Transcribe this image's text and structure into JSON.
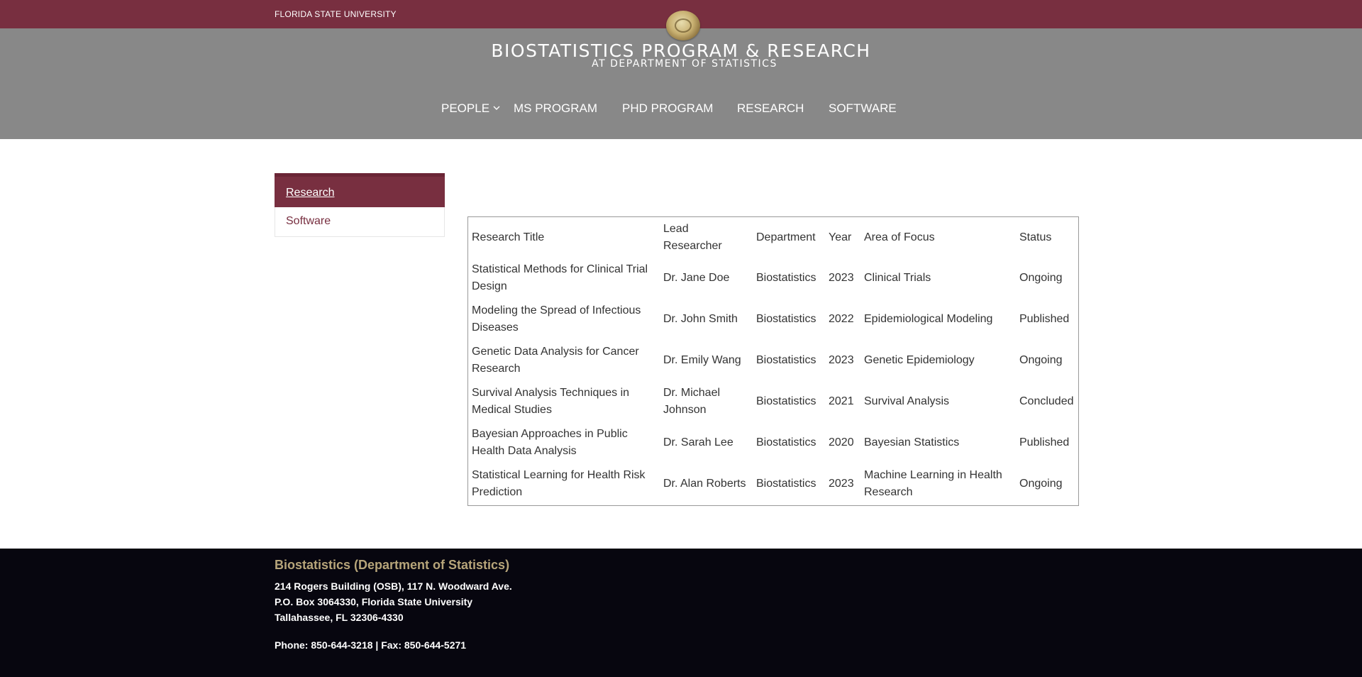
{
  "topbar": {
    "university": "FLORIDA STATE UNIVERSITY"
  },
  "header": {
    "title": "BIOSTATISTICS PROGRAM & RESEARCH",
    "subtitle": "AT DEPARTMENT OF STATISTICS",
    "seal_icon": "university-seal-icon"
  },
  "nav": {
    "items": [
      {
        "label": "PEOPLE",
        "has_dropdown": true
      },
      {
        "label": "MS PROGRAM"
      },
      {
        "label": "PHD PROGRAM"
      },
      {
        "label": "RESEARCH"
      },
      {
        "label": "SOFTWARE"
      }
    ]
  },
  "sidebar": {
    "items": [
      {
        "label": "Research",
        "active": true
      },
      {
        "label": "Software",
        "active": false
      }
    ]
  },
  "table": {
    "headers": [
      "Research Title",
      "Lead Researcher",
      "Department",
      "Year",
      "Area of Focus",
      "Status"
    ],
    "rows": [
      [
        "Statistical Methods for Clinical Trial Design",
        "Dr. Jane Doe",
        "Biostatistics",
        "2023",
        "Clinical Trials",
        "Ongoing"
      ],
      [
        "Modeling the Spread of Infectious Diseases",
        "Dr. John Smith",
        "Biostatistics",
        "2022",
        "Epidemiological Modeling",
        "Published"
      ],
      [
        "Genetic Data Analysis for Cancer Research",
        "Dr. Emily Wang",
        "Biostatistics",
        "2023",
        "Genetic Epidemiology",
        "Ongoing"
      ],
      [
        "Survival Analysis Techniques in Medical Studies",
        "Dr. Michael Johnson",
        "Biostatistics",
        "2021",
        "Survival Analysis",
        "Concluded"
      ],
      [
        "Bayesian Approaches in Public Health Data Analysis",
        "Dr. Sarah Lee",
        "Biostatistics",
        "2020",
        "Bayesian Statistics",
        "Published"
      ],
      [
        "Statistical Learning for Health Risk Prediction",
        "Dr. Alan Roberts",
        "Biostatistics",
        "2023",
        "Machine Learning in Health Research",
        "Ongoing"
      ]
    ]
  },
  "footer": {
    "title": "Biostatistics (Department of Statistics)",
    "address_line1": "214 Rogers Building (OSB), 117 N. Woodward Ave.",
    "address_line2": "P.O. Box 3064330, Florida State University",
    "address_line3": "Tallahassee, FL 32306-4330",
    "contact": "Phone: 850-644-3218 | Fax: 850-644-5271"
  },
  "colors": {
    "garnet": "#782f40",
    "header_gray": "#888888",
    "gold": "#b7a57a",
    "footer_bg": "#07060f"
  }
}
